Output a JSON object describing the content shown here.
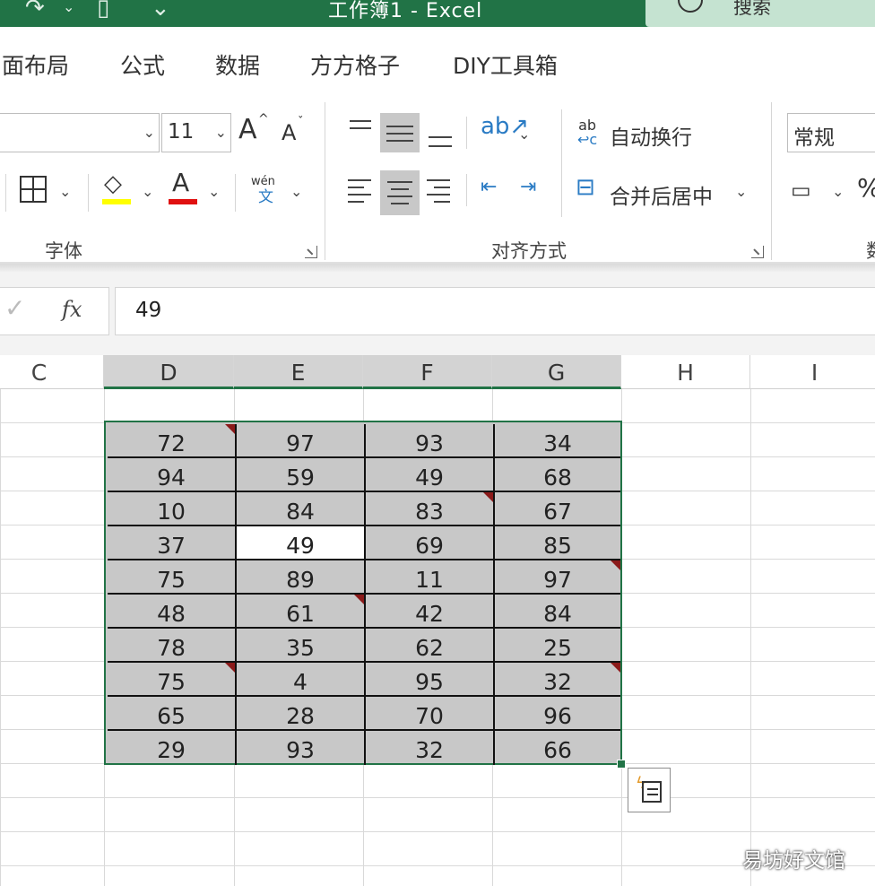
{
  "window": {
    "title": "工作簿1  -  Excel",
    "search_label": "搜索"
  },
  "tabs": [
    "面布局",
    "公式",
    "数据",
    "方方格子",
    "DIY工具箱"
  ],
  "ribbon": {
    "font_size": "11",
    "grow_font": "A",
    "shrink_font": "A",
    "font_group_label": "字体",
    "wen_label": "wén",
    "wen_sub": "文",
    "wrap_text_label": "自动换行",
    "merge_center_label": "合并后居中",
    "alignment_group_label": "对齐方式",
    "number_format": "常规",
    "number_group_partial": "数",
    "colors": {
      "fill_highlight": "#ffff00",
      "font_color": "#e01010",
      "accent": "#217346"
    }
  },
  "formula_bar": {
    "fx_label": "fx",
    "value": "49"
  },
  "columns": [
    "C",
    "D",
    "E",
    "F",
    "G",
    "H",
    "I"
  ],
  "selected_columns": [
    "D",
    "E",
    "F",
    "G"
  ],
  "table": {
    "rows": [
      [
        "72",
        "97",
        "93",
        "34"
      ],
      [
        "94",
        "59",
        "49",
        "68"
      ],
      [
        "10",
        "84",
        "83",
        "67"
      ],
      [
        "37",
        "49",
        "69",
        "85"
      ],
      [
        "75",
        "89",
        "11",
        "97"
      ],
      [
        "48",
        "61",
        "42",
        "84"
      ],
      [
        "78",
        "35",
        "62",
        "25"
      ],
      [
        "75",
        "4",
        "95",
        "32"
      ],
      [
        "65",
        "28",
        "70",
        "96"
      ],
      [
        "29",
        "93",
        "32",
        "66"
      ]
    ],
    "active_cell": [
      3,
      1
    ],
    "comment_markers": [
      [
        0,
        0
      ],
      [
        2,
        2
      ],
      [
        4,
        3
      ],
      [
        5,
        1
      ],
      [
        7,
        0
      ],
      [
        7,
        3
      ]
    ]
  },
  "watermark": "易坊好文馆"
}
